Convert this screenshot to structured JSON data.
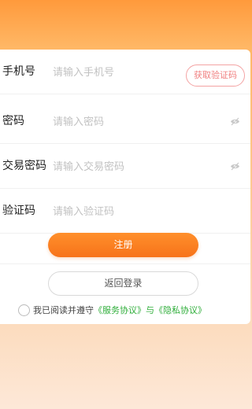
{
  "form": {
    "phone": {
      "label": "手机号",
      "placeholder": "请输入手机号",
      "value": ""
    },
    "get_code_label": "获取验证码",
    "password": {
      "label": "密码",
      "placeholder": "请输入密码",
      "value": ""
    },
    "trade_password": {
      "label": "交易密码",
      "placeholder": "请输入交易密码",
      "value": ""
    },
    "verify_code": {
      "label": "验证码",
      "placeholder": "请输入验证码",
      "value": ""
    }
  },
  "actions": {
    "register_label": "注册",
    "back_login_label": "返回登录"
  },
  "agreement": {
    "prefix": "我已阅读并遵守",
    "service_link": "《服务协议》",
    "conjunction": "与",
    "privacy_link": "《隐私协议》",
    "checked": false
  },
  "icons": {
    "password_toggle": "eye-hidden-icon",
    "trade_password_toggle": "eye-hidden-icon"
  },
  "colors": {
    "accent": "#f7731a",
    "link": "#2fae3a",
    "code_button": "#f08080"
  }
}
